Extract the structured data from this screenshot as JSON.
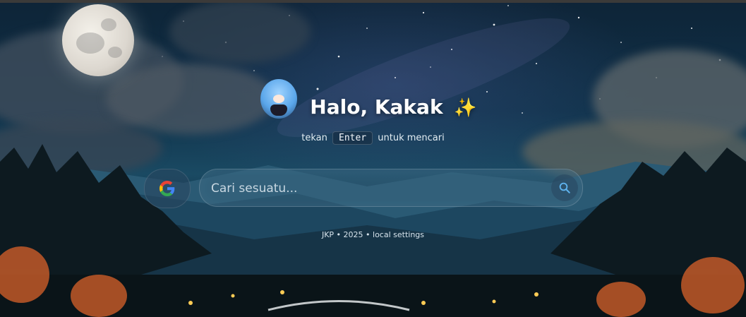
{
  "header": {
    "greeting": "Halo, Kakak",
    "sparkle": "✨"
  },
  "hint": {
    "before": "tekan",
    "key": "Enter",
    "after": "untuk mencari"
  },
  "search": {
    "engine": "Google",
    "placeholder": "Cari sesuatu...",
    "value": ""
  },
  "footer": {
    "text": "JKP • 2025 • local settings"
  },
  "colors": {
    "accent": "#5fb4f0",
    "text": "#ffffff"
  },
  "icons": {
    "engine": "google-icon",
    "search": "search-icon"
  }
}
